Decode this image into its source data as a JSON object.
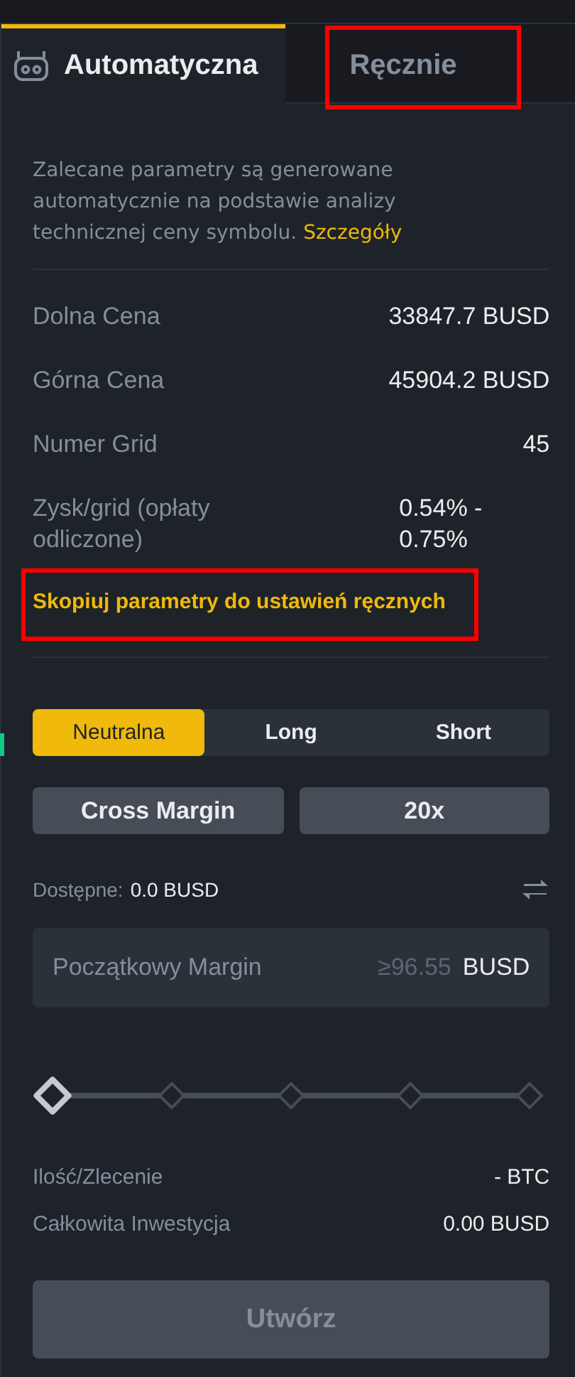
{
  "tabs": [
    {
      "label": "Automatyczna",
      "selected": true,
      "highlighted": false
    },
    {
      "label": "Ręcznie",
      "selected": false,
      "highlighted": true
    }
  ],
  "intro": {
    "text": "Zalecane parametry są generowane automatycznie na podstawie analizy technicznej ceny symbolu.",
    "link": "Szczegóły"
  },
  "parameters": [
    {
      "label": "Dolna Cena",
      "value": "33847.7 BUSD"
    },
    {
      "label": "Górna Cena",
      "value": "45904.2 BUSD"
    },
    {
      "label": "Numer Grid",
      "value": "45"
    },
    {
      "label": "Zysk/grid (opłaty odliczone)",
      "value": "0.54% - 0.75%"
    }
  ],
  "copy_link": {
    "label": "Skopiuj parametry do ustawień ręcznych",
    "highlighted": true
  },
  "direction": [
    {
      "label": "Neutralna",
      "selected": true
    },
    {
      "label": "Long",
      "selected": false
    },
    {
      "label": "Short",
      "selected": false
    }
  ],
  "margin_mode": "Cross Margin",
  "leverage": "20x",
  "available": {
    "label": "Dostępne:",
    "value": "0.0 BUSD"
  },
  "margin_field": {
    "placeholder": "Początkowy Margin",
    "minimum": "≥96.55",
    "unit": "BUSD"
  },
  "slider": {
    "level": 0
  },
  "summary": [
    {
      "label": "Ilość/Zlecenie",
      "value": "- BTC"
    },
    {
      "label": "Całkowita Inwestycja",
      "value": "0.00 BUSD"
    }
  ],
  "submit": {
    "label": "Utwórz",
    "disabled": true
  }
}
